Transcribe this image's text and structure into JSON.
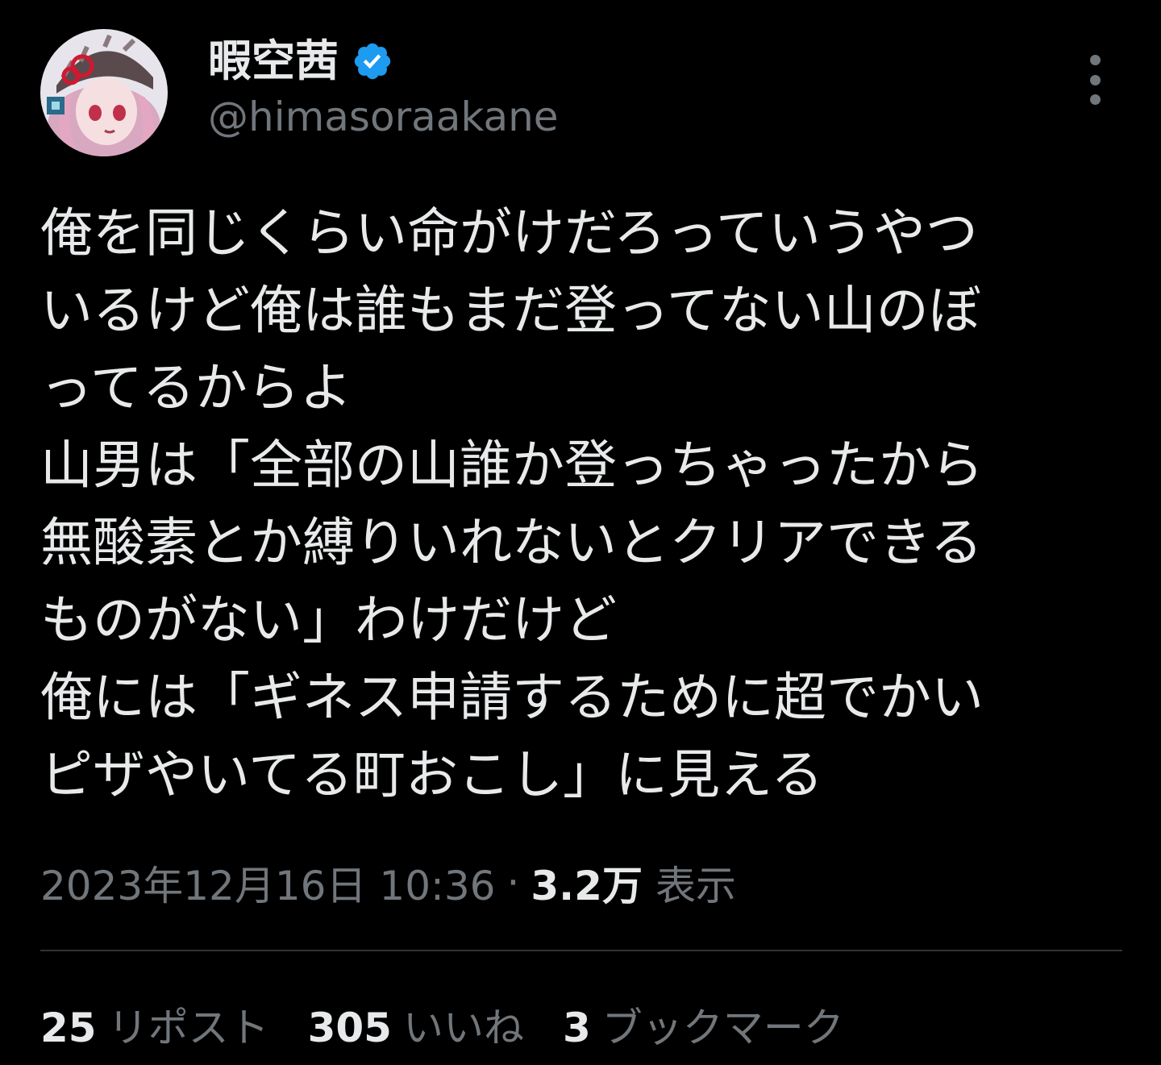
{
  "author": {
    "display_name": "暇空茜",
    "handle": "@himasoraakane",
    "verified_icon": "verified-badge-icon",
    "avatar_icon": "avatar-image"
  },
  "menu": {
    "more_icon": "more-vertical-icon"
  },
  "tweet": {
    "text": "俺を同じくらい命がけだろっていうやつ\nいるけど俺は誰もまだ登ってない山のぼ\nってるからよ\n山男は「全部の山誰か登っちゃったから\n無酸素とか縛りいれないとクリアできる\nものがない」わけだけど\n俺には「ギネス申請するために超でかい\nピザやいてる町おこし」に見える"
  },
  "meta": {
    "timestamp": "2023年12月16日 10:36",
    "separator": "·",
    "views_count": "3.2万",
    "views_label": "表示"
  },
  "stats": {
    "reposts_count": "25",
    "reposts_label": "リポスト",
    "likes_count": "305",
    "likes_label": "いいね",
    "bookmarks_count": "3",
    "bookmarks_label": "ブックマーク"
  },
  "colors": {
    "background": "#000000",
    "primary_text": "#e7e9ea",
    "secondary_text": "#71767b",
    "verified_blue": "#1d9bf0",
    "divider": "#2f3336"
  }
}
